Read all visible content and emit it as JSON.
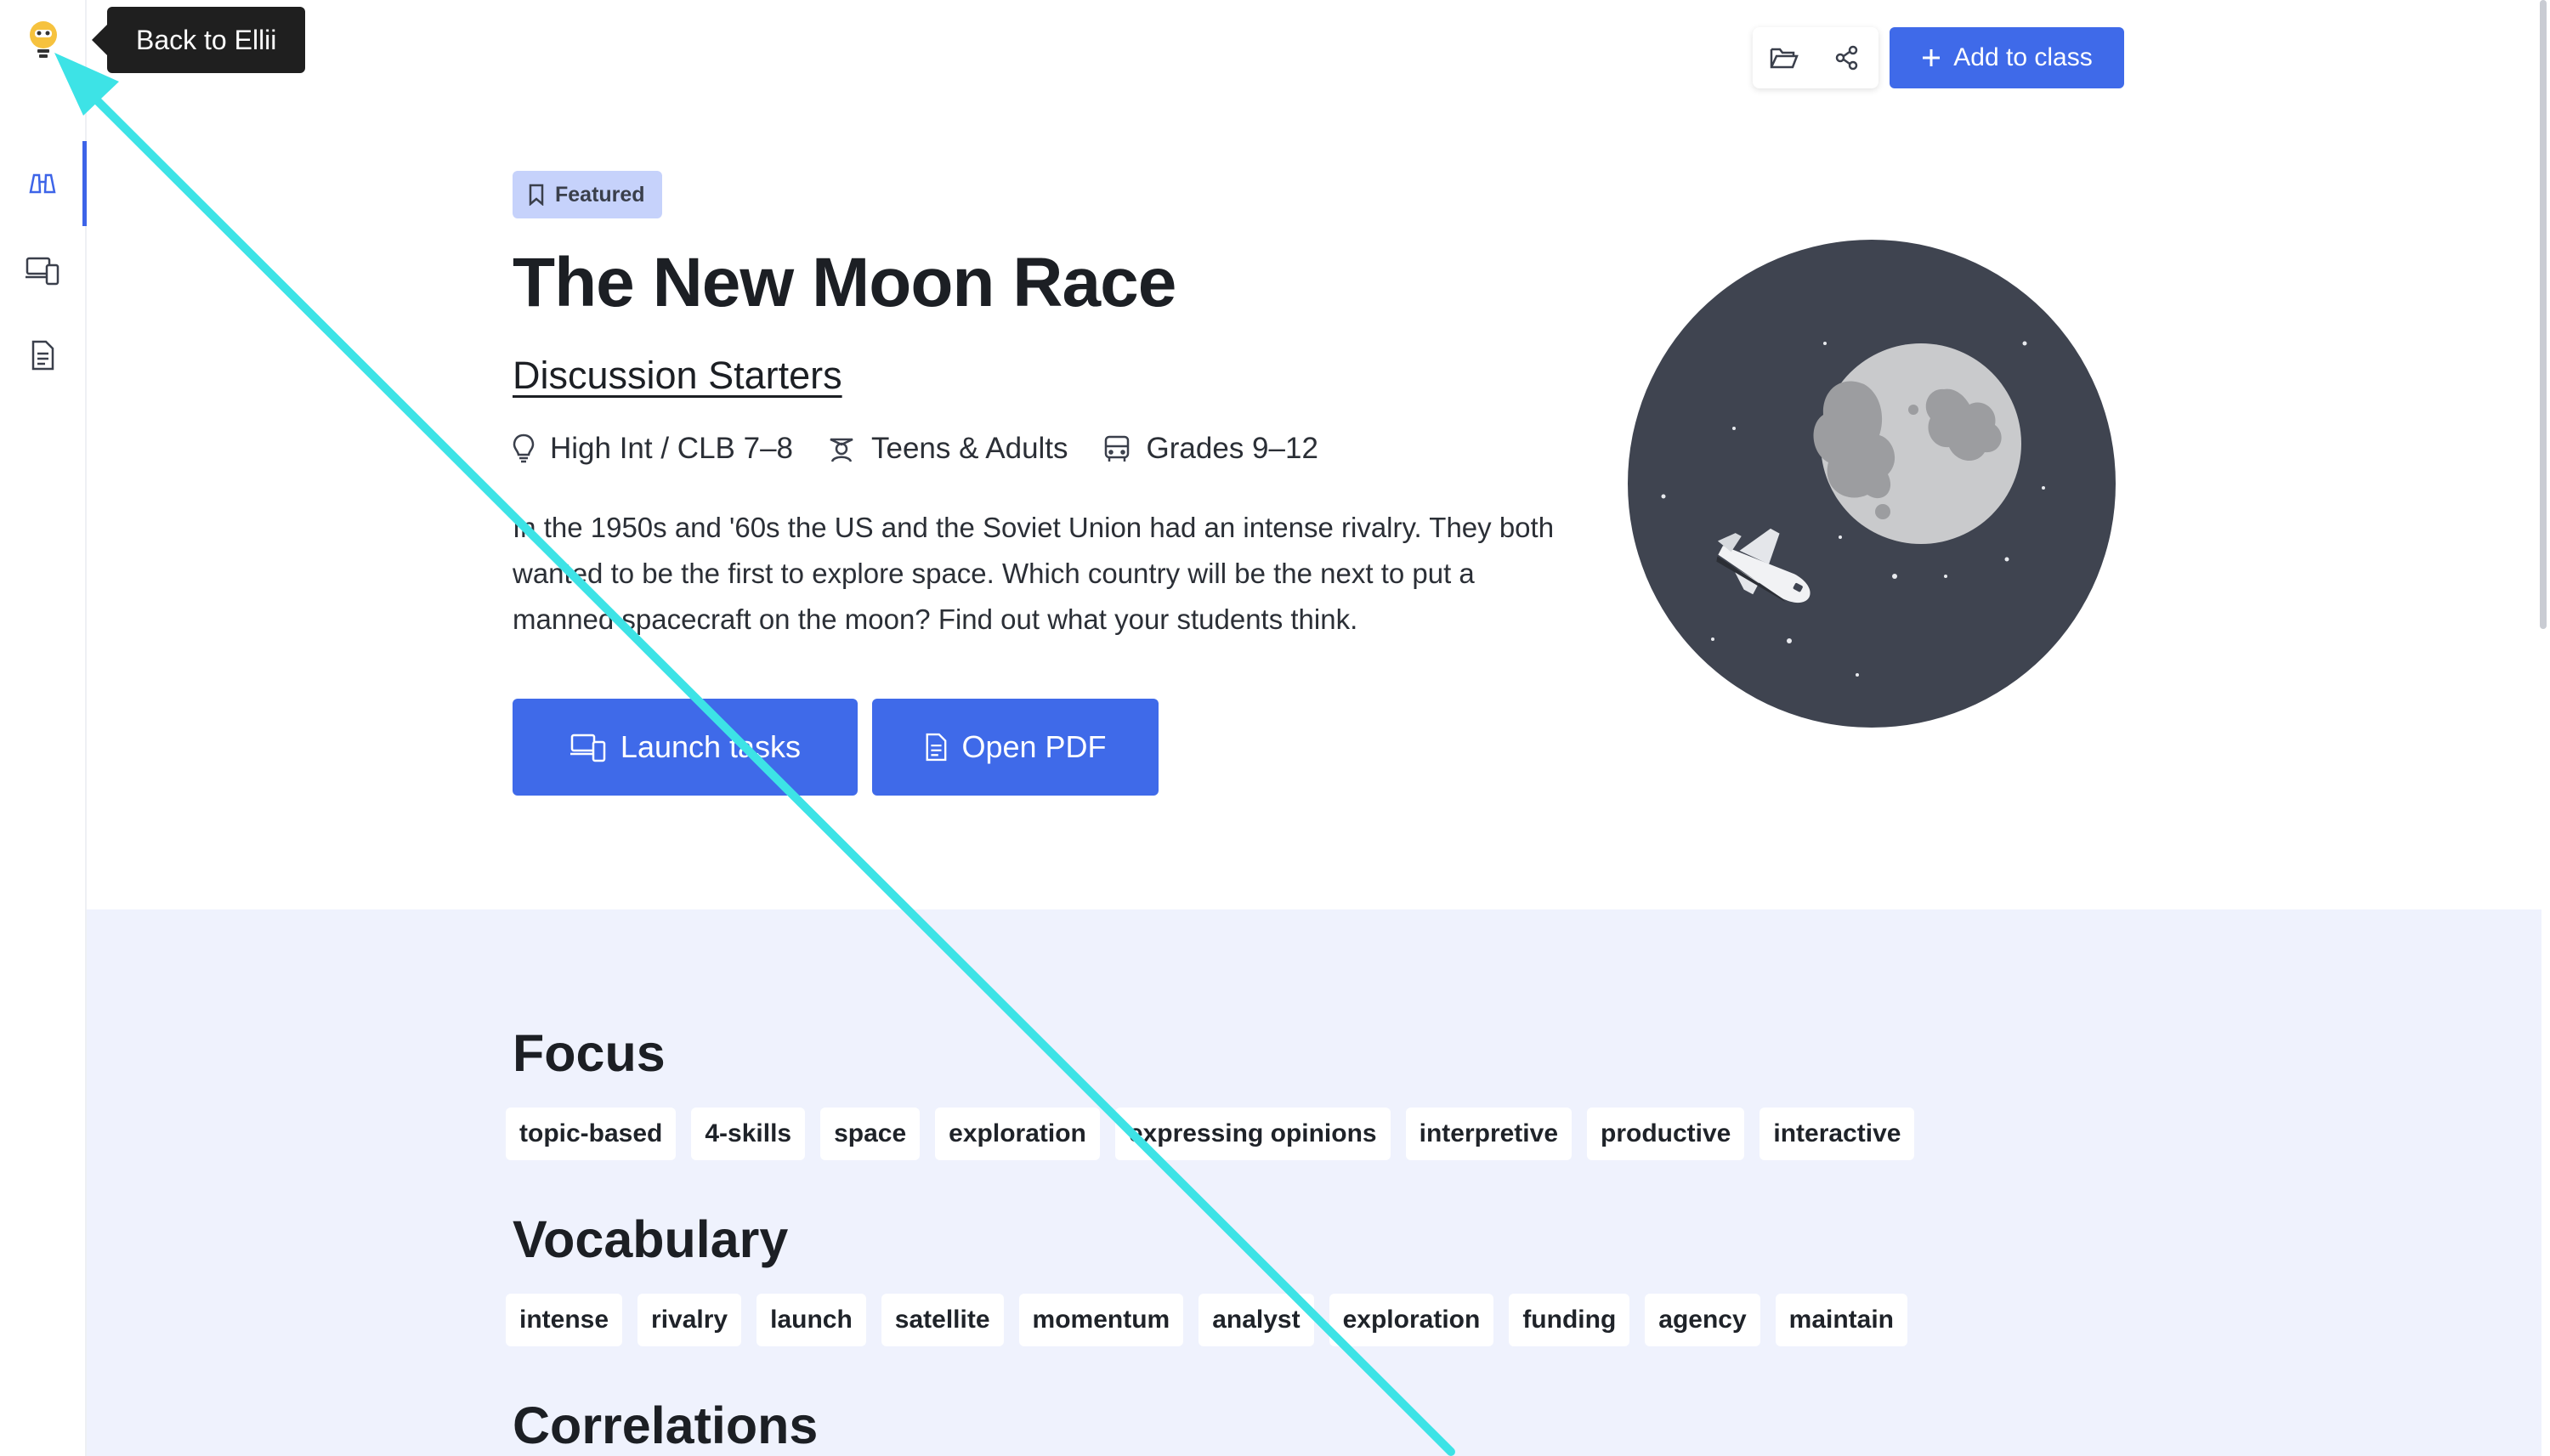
{
  "tooltip": "Back to Ellii",
  "toolbar": {
    "add_to_class": "Add to class"
  },
  "hero": {
    "badge": "Featured",
    "title": "The New Moon Race",
    "category": "Discussion Starters",
    "meta": {
      "level": "High Int / CLB 7–8",
      "audience": "Teens & Adults",
      "grades": "Grades 9–12"
    },
    "description": "In the 1950s and '60s the US and the Soviet Union had an intense rivalry. They both wanted to be the first to explore space. Which country will be the next to put a manned spacecraft on the moon? Find out what your students think.",
    "launch_label": "Launch tasks",
    "pdf_label": "Open PDF"
  },
  "focus": {
    "title": "Focus",
    "tags": [
      "topic-based",
      "4-skills",
      "space",
      "exploration",
      "expressing opinions",
      "interpretive",
      "productive",
      "interactive"
    ]
  },
  "vocabulary": {
    "title": "Vocabulary",
    "tags": [
      "intense",
      "rivalry",
      "launch",
      "satellite",
      "momentum",
      "analyst",
      "exploration",
      "funding",
      "agency",
      "maintain"
    ]
  },
  "correlations": {
    "title": "Correlations"
  },
  "colors": {
    "accent": "#3f6ae9",
    "badge_bg": "#c6d2fb",
    "section_bg": "#eff2fd",
    "annotation": "#3de3e6"
  }
}
